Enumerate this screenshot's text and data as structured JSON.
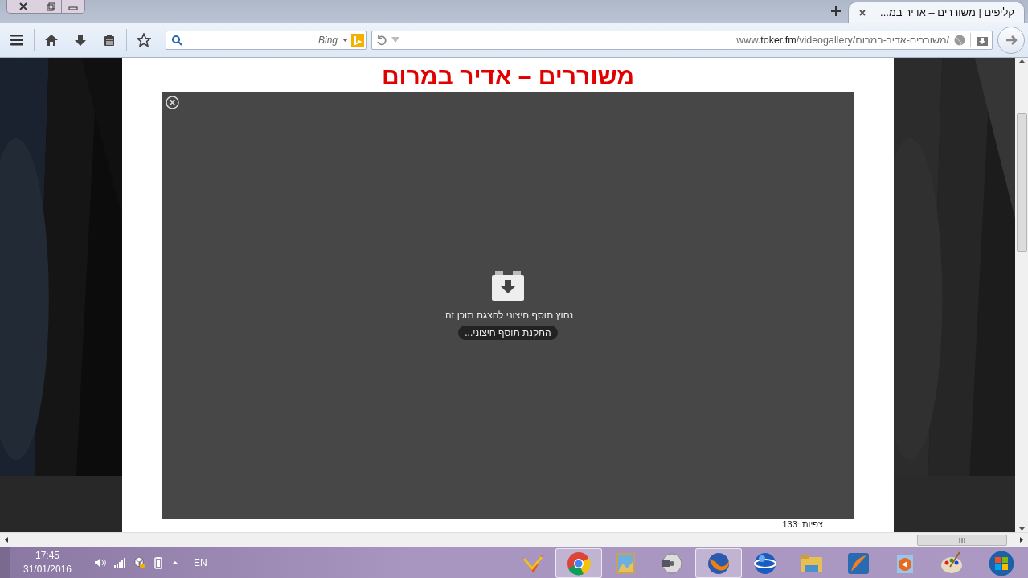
{
  "tabs": [
    {
      "label": "קליפים | משוררים – אדיר במ...",
      "selected": true
    }
  ],
  "toolbar": {
    "search": {
      "placeholder": "Bing"
    },
    "address": {
      "prefix": "www.",
      "domain": "toker.fm",
      "path": "/videogallery/משוררים-אדיר-במרום/"
    }
  },
  "page": {
    "title": "משוררים – אדיר במרום",
    "plugin": {
      "message": "נחוץ תוסף חיצוני להצגת תוכן זה.",
      "button": "התקנת תוסף חיצוני..."
    },
    "views": "צפיות :133"
  },
  "taskbar": {
    "time": "17:45",
    "date": "31/01/2016",
    "language": "EN",
    "apps": [
      {
        "selected": false
      },
      {
        "selected": true
      },
      {
        "selected": false
      },
      {
        "selected": false
      },
      {
        "selected": true
      },
      {
        "selected": false
      },
      {
        "selected": false
      },
      {
        "selected": false
      },
      {
        "selected": false
      },
      {
        "selected": false
      }
    ]
  }
}
